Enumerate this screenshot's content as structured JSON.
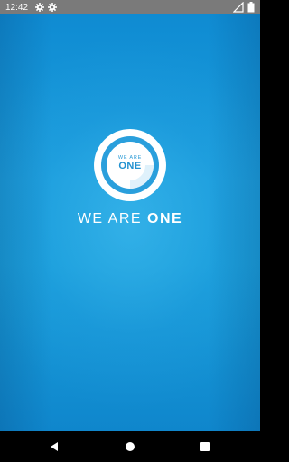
{
  "status_bar": {
    "time": "12:42",
    "icons": [
      "settings-icon",
      "settings-icon",
      "signal-icon",
      "battery-icon"
    ]
  },
  "splash": {
    "logo": {
      "small_text": "WE ARE",
      "big_text": "ONE",
      "ring_color": "#ffffff",
      "inner_text_color": "#2191d0"
    },
    "brand": {
      "prefix": "WE ARE",
      "strong": "ONE"
    },
    "background_color": "#1aa0dc"
  },
  "nav_bar": {
    "buttons": [
      "back-icon",
      "home-icon",
      "recents-icon"
    ]
  }
}
